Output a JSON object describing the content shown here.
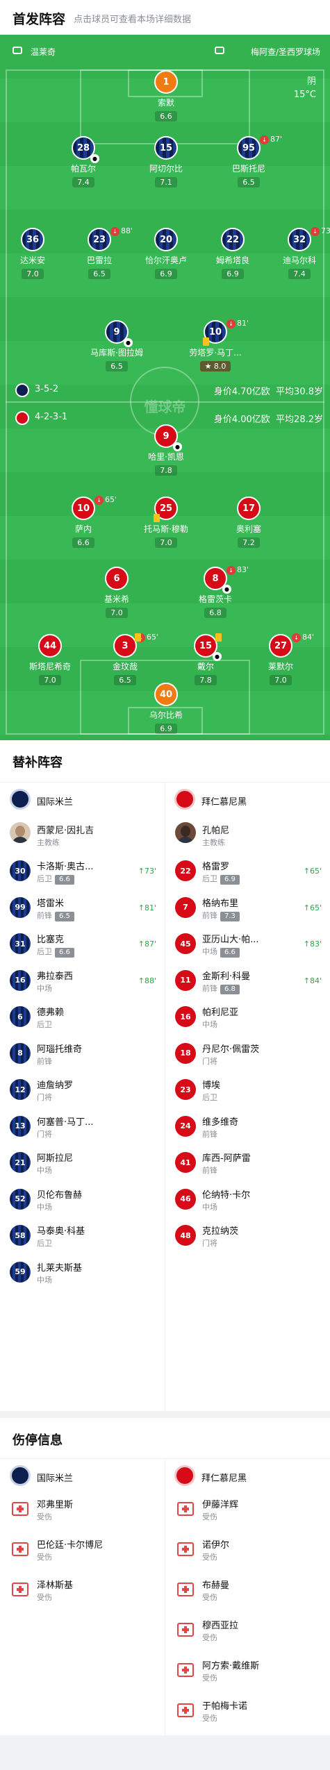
{
  "header": {
    "title": "首发阵容",
    "subtitle": "点击球员可查看本场详细数据"
  },
  "pitch": {
    "home_team": "温莱奇",
    "away_venue": "梅阿查/圣西罗球场",
    "weather": "阴",
    "temperature": "15°C",
    "watermark": "懂球帝",
    "inter_formation": "3-5-2",
    "inter_value": "身价4.70亿欧",
    "inter_age": "平均30.8岁",
    "bayern_formation": "4-2-3-1",
    "bayern_value": "身价4.00亿欧",
    "bayern_age": "平均28.2岁",
    "players": [
      {
        "num": "1",
        "name": "索默",
        "rating": "6.6",
        "team": "gk"
      },
      {
        "num": "28",
        "name": "帕瓦尔",
        "rating": "7.4",
        "team": "inter"
      },
      {
        "num": "15",
        "name": "阿切尔比",
        "rating": "7.1",
        "team": "inter"
      },
      {
        "num": "95",
        "name": "巴斯托尼",
        "rating": "6.5",
        "team": "inter",
        "min": "87'"
      },
      {
        "num": "36",
        "name": "达米安",
        "rating": "7.0",
        "team": "inter"
      },
      {
        "num": "23",
        "name": "巴雷拉",
        "rating": "6.5",
        "team": "inter",
        "min": "88'"
      },
      {
        "num": "20",
        "name": "恰尔汗奥卢",
        "rating": "6.9",
        "team": "inter"
      },
      {
        "num": "22",
        "name": "姆希塔良",
        "rating": "6.9",
        "team": "inter"
      },
      {
        "num": "32",
        "name": "迪马尔科",
        "rating": "7.4",
        "team": "inter",
        "min": "73'"
      },
      {
        "num": "9",
        "name": "马库斯·图拉姆",
        "rating": "6.5",
        "team": "inter"
      },
      {
        "num": "10",
        "name": "劳塔罗·马丁...",
        "rating": "8.0",
        "team": "inter",
        "min": "81'"
      },
      {
        "num": "9",
        "name": "哈里·凯恩",
        "rating": "7.8",
        "team": "bay"
      },
      {
        "num": "10",
        "name": "萨内",
        "rating": "6.6",
        "team": "bay",
        "min": "65'"
      },
      {
        "num": "25",
        "name": "托马斯·穆勒",
        "rating": "7.0",
        "team": "bay"
      },
      {
        "num": "17",
        "name": "奥利塞",
        "rating": "7.2",
        "team": "bay"
      },
      {
        "num": "6",
        "name": "基米希",
        "rating": "7.0",
        "team": "bay"
      },
      {
        "num": "8",
        "name": "格雷茨卡",
        "rating": "6.8",
        "team": "bay",
        "min": "83'"
      },
      {
        "num": "44",
        "name": "斯塔尼希奇",
        "rating": "7.0",
        "team": "bay"
      },
      {
        "num": "3",
        "name": "金玟哉",
        "rating": "6.5",
        "team": "bay",
        "min": "65'"
      },
      {
        "num": "15",
        "name": "戴尔",
        "rating": "7.8",
        "team": "bay"
      },
      {
        "num": "27",
        "name": "莱默尔",
        "rating": "7.0",
        "team": "bay",
        "min": "84'"
      },
      {
        "num": "40",
        "name": "乌尔比希",
        "rating": "6.9",
        "team": "gk"
      }
    ]
  },
  "subs": {
    "title": "替补阵容",
    "inter": "国际米兰",
    "bayern": "拜仁慕尼黑",
    "coach_left": {
      "name": "西蒙尼·因扎吉",
      "role": "主教练"
    },
    "coach_right": {
      "name": "孔帕尼",
      "role": "主教练"
    },
    "left": [
      {
        "num": "30",
        "name": "卡洛斯·奥古...",
        "pos": "后卫",
        "rating": "6.6",
        "in": "73'"
      },
      {
        "num": "99",
        "name": "塔雷米",
        "pos": "前锋",
        "rating": "6.5",
        "in": "81'"
      },
      {
        "num": "31",
        "name": "比塞克",
        "pos": "后卫",
        "rating": "6.6",
        "in": "87'"
      },
      {
        "num": "16",
        "name": "弗拉泰西",
        "pos": "中场",
        "rating": "",
        "in": "88'"
      },
      {
        "num": "6",
        "name": "德弗赖",
        "pos": "后卫",
        "rating": "",
        "in": ""
      },
      {
        "num": "8",
        "name": "阿瑙托维奇",
        "pos": "前锋",
        "rating": "",
        "in": ""
      },
      {
        "num": "12",
        "name": "迪詹纳罗",
        "pos": "门将",
        "rating": "",
        "in": ""
      },
      {
        "num": "13",
        "name": "何塞普·马丁...",
        "pos": "门将",
        "rating": "",
        "in": ""
      },
      {
        "num": "21",
        "name": "阿斯拉尼",
        "pos": "中场",
        "rating": "",
        "in": ""
      },
      {
        "num": "52",
        "name": "贝伦布鲁赫",
        "pos": "中场",
        "rating": "",
        "in": ""
      },
      {
        "num": "58",
        "name": "马泰奥·科基",
        "pos": "后卫",
        "rating": "",
        "in": ""
      },
      {
        "num": "59",
        "name": "扎莱夫斯基",
        "pos": "中场",
        "rating": "",
        "in": ""
      }
    ],
    "right": [
      {
        "num": "22",
        "name": "格雷罗",
        "pos": "后卫",
        "rating": "6.9",
        "in": "65'"
      },
      {
        "num": "7",
        "name": "格纳布里",
        "pos": "前锋",
        "rating": "7.3",
        "in": "65'"
      },
      {
        "num": "45",
        "name": "亚历山大·帕...",
        "pos": "中场",
        "rating": "6.6",
        "in": "83'"
      },
      {
        "num": "11",
        "name": "金斯利·科曼",
        "pos": "前锋",
        "rating": "6.8",
        "in": "84'"
      },
      {
        "num": "16",
        "name": "帕利尼亚",
        "pos": "中场",
        "rating": "",
        "in": ""
      },
      {
        "num": "18",
        "name": "丹尼尔·佩雷茨",
        "pos": "门将",
        "rating": "",
        "in": ""
      },
      {
        "num": "23",
        "name": "博埃",
        "pos": "后卫",
        "rating": "",
        "in": ""
      },
      {
        "num": "24",
        "name": "维多维奇",
        "pos": "前锋",
        "rating": "",
        "in": ""
      },
      {
        "num": "41",
        "name": "库西-阿萨雷",
        "pos": "前锋",
        "rating": "",
        "in": ""
      },
      {
        "num": "46",
        "name": "伦纳特·卡尔",
        "pos": "中场",
        "rating": "",
        "in": ""
      },
      {
        "num": "48",
        "name": "克拉纳茨",
        "pos": "门将",
        "rating": "",
        "in": ""
      }
    ]
  },
  "injuries": {
    "title": "伤停信息",
    "inter": "国际米兰",
    "bayern": "拜仁慕尼黑",
    "left": [
      {
        "name": "邓弗里斯",
        "status": "受伤"
      },
      {
        "name": "巴伦廷·卡尔博尼",
        "status": "受伤"
      },
      {
        "name": "泽林斯基",
        "status": "受伤"
      }
    ],
    "right": [
      {
        "name": "伊藤洋辉",
        "status": "受伤"
      },
      {
        "name": "诺伊尔",
        "status": "受伤"
      },
      {
        "name": "布赫曼",
        "status": "受伤"
      },
      {
        "name": "穆西亚拉",
        "status": "受伤"
      },
      {
        "name": "阿方索·戴维斯",
        "status": "受伤"
      },
      {
        "name": "于帕梅卡诺",
        "status": "受伤"
      }
    ]
  }
}
